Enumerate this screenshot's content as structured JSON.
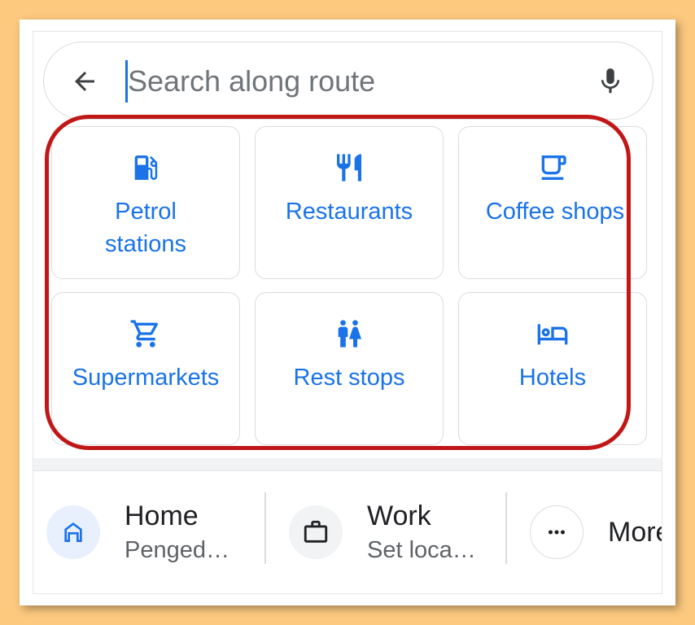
{
  "search": {
    "placeholder": "Search along route",
    "back_icon": "arrow-left-icon",
    "mic_icon": "microphone-icon"
  },
  "categories": [
    {
      "label": "Petrol stations",
      "icon": "gas-station-icon"
    },
    {
      "label": "Restaurants",
      "icon": "fork-knife-icon"
    },
    {
      "label": "Coffee shops",
      "icon": "coffee-cup-icon"
    },
    {
      "label": "Supermarkets",
      "icon": "shopping-cart-icon"
    },
    {
      "label": "Rest stops",
      "icon": "restroom-icon"
    },
    {
      "label": "Hotels",
      "icon": "bed-icon"
    }
  ],
  "shortcuts": {
    "home": {
      "title": "Home",
      "subtitle": "Penged…",
      "icon": "home-icon"
    },
    "work": {
      "title": "Work",
      "subtitle": "Set loca…",
      "icon": "briefcase-icon"
    },
    "more": {
      "title": "More",
      "icon": "more-dots-icon"
    }
  },
  "colors": {
    "accent": "#1a73e8",
    "highlight": "#c11717",
    "background": "#fdc97f"
  }
}
